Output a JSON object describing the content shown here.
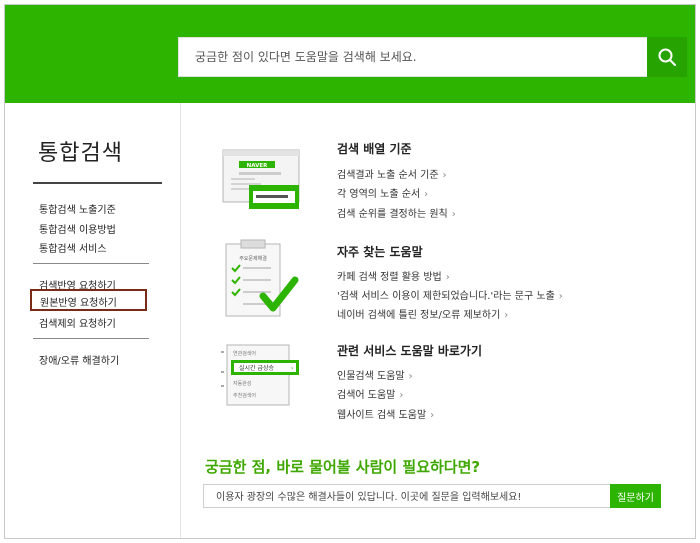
{
  "search": {
    "placeholder": "궁금한 점이 있다면 도움말을 검색해 보세요.",
    "button_icon": "search-icon"
  },
  "sidebar": {
    "title": "통합검색",
    "groups": [
      [
        "통합검색 노출기준",
        "통합검색 이용방법",
        "통합검색 서비스"
      ],
      [
        "검색반영 요청하기",
        "원본반영 요청하기",
        "검색제외 요청하기"
      ],
      [
        "장애/오류 해결하기"
      ]
    ],
    "active_item": "원본반영 요청하기"
  },
  "sections": [
    {
      "title": "검색 배열 기준",
      "links": [
        "검색결과 노출 순서 기준",
        "각 영역의 노출 순서",
        "검색 순위를 결정하는 원칙"
      ],
      "illustration": {
        "brand_label": "NAVER"
      }
    },
    {
      "title": "자주 찾는 도움말",
      "links": [
        "카페 검색 정렬 활용 방법",
        "'검색 서비스 이용이 제한되었습니다.'라는 문구 노출",
        "네이버 검색에 틀린 정보/오류 제보하기"
      ],
      "illustration": {
        "clipboard_label": "주요문제해결"
      }
    },
    {
      "title": "관련 서비스 도움말 바로가기",
      "links": [
        "인물검색 도움말",
        "검색어 도움말",
        "웹사이트 검색 도움말"
      ],
      "illustration": {
        "menu_items": [
          "연관검색어",
          "실시간 급상승",
          "자동완성",
          "추천검색어"
        ]
      }
    }
  ],
  "link_arrow": "›",
  "ask": {
    "title": "궁금한 점, 바로 물어볼 사람이 필요하다면?",
    "placeholder": "이용자 광장의 수많은 해결사들이 있답니다. 이곳에 질문을 입력해보세요!",
    "button_label": "질문하기"
  },
  "colors": {
    "brand_green": "#2db400",
    "title_green": "#3ea800",
    "active_border": "#7a2b16"
  }
}
